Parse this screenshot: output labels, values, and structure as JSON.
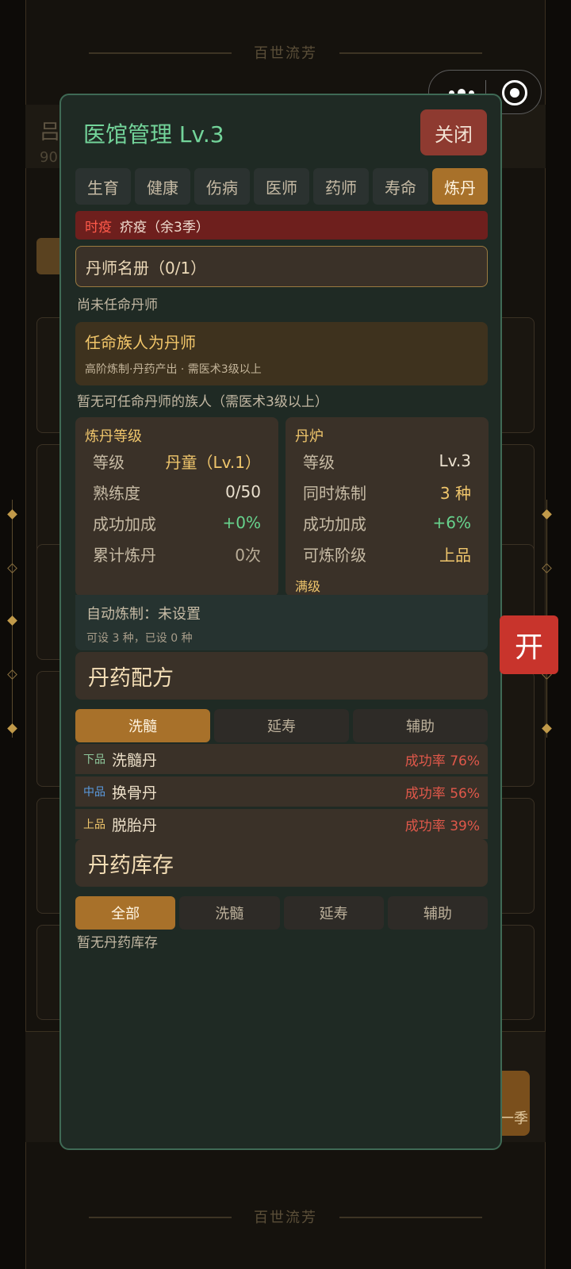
{
  "background": {
    "banner_text": "百世流芳",
    "header_title": "吕",
    "header_sub": "90",
    "season_text": "一季"
  },
  "capsule": {
    "more_icon": "more-dots-icon",
    "close_icon": "record-circle-icon"
  },
  "side_button": {
    "label": "开",
    "color": "#c8342c"
  },
  "modal": {
    "title": "医馆管理 Lv.3",
    "close_label": "关闭",
    "tabs": [
      "生育",
      "健康",
      "伤病",
      "医师",
      "药师",
      "寿命",
      "炼丹"
    ],
    "active_tab": "炼丹",
    "epidemic": {
      "tag": "时疫",
      "text": "疥疫（余3季）"
    },
    "registry": {
      "title": "丹师名册（0/1）",
      "empty_note": "尚未任命丹师"
    },
    "appoint": {
      "title": "任命族人为丹师",
      "desc": "高阶炼制·丹药产出 · 需医术3级以上",
      "note": "暂无可任命丹师的族人（需医术3级以上）"
    },
    "alchemy_level": {
      "title": "炼丹等级",
      "rows": [
        {
          "k": "等级",
          "v": "丹童（Lv.1）"
        },
        {
          "k": "熟练度",
          "v": "0/50"
        },
        {
          "k": "成功加成",
          "v": "+0%"
        },
        {
          "k": "累计炼丹",
          "v": "0次"
        }
      ]
    },
    "furnace": {
      "title": "丹炉",
      "rows": [
        {
          "k": "等级",
          "v": "Lv.3"
        },
        {
          "k": "同时炼制",
          "v": "3 种"
        },
        {
          "k": "成功加成",
          "v": "+6%"
        },
        {
          "k": "可炼阶级",
          "v": "上品"
        }
      ],
      "footer": "满级"
    },
    "auto": {
      "title": "自动炼制：未设置",
      "desc": "可设 3 种，已设 0 种"
    },
    "recipes": {
      "title": "丹药配方",
      "tabs": [
        "洗髓",
        "延寿",
        "辅助"
      ],
      "active_tab": "洗髓",
      "items": [
        {
          "grade": "下品",
          "name": "洗髓丹",
          "rate": "成功率 76%"
        },
        {
          "grade": "中品",
          "name": "换骨丹",
          "rate": "成功率 56%"
        },
        {
          "grade": "上品",
          "name": "脱胎丹",
          "rate": "成功率 39%"
        }
      ]
    },
    "inventory": {
      "title": "丹药库存",
      "tabs": [
        "全部",
        "洗髓",
        "延寿",
        "辅助"
      ],
      "active_tab": "全部",
      "empty_note": "暂无丹药库存"
    }
  }
}
